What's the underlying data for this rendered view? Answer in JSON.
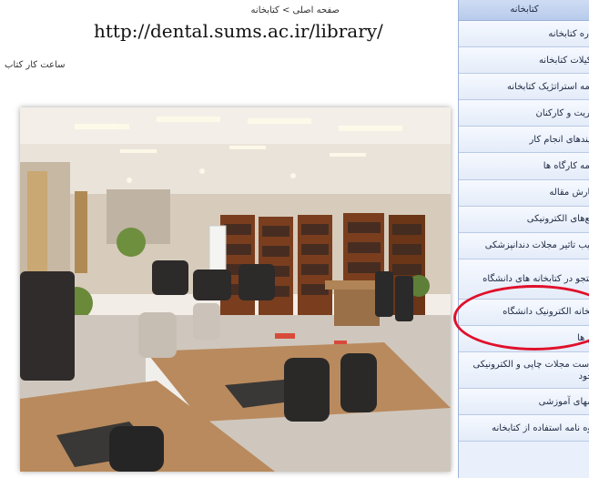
{
  "breadcrumb": "صفحه اصلی > کتابخانه",
  "url_overlay": "http://dental.sums.ac.ir/library/",
  "hours_text": "ساعت کار کتاب",
  "sidebar": {
    "header": "کتابخانه",
    "items": [
      {
        "label": "درباره کتابخانه"
      },
      {
        "label": "تشکیلات کتابخانه"
      },
      {
        "label": "برنامه استراتژیک کتابخانه"
      },
      {
        "label": "مدیریت و کارکنان"
      },
      {
        "label": "فرایندهای انجام کار"
      },
      {
        "label": "برنامه کارگاه ها"
      },
      {
        "label": "سفارش مقاله"
      },
      {
        "label": "منابع‌های الکترونیکی"
      },
      {
        "label": "ضریب تاثیر مجلات دندانپزشکی"
      },
      {
        "label": "جستجو در کتابخانه های دانشگاه"
      },
      {
        "label": "کتابخانه الکترونیک دانشگاه"
      },
      {
        "label": "فرم ها"
      },
      {
        "label": "فهرست مجلات چاپی و الکترونیکی موجود"
      },
      {
        "label": "فیلمهای آموزشی"
      },
      {
        "label": "شیوه نامه استفاده از کتابخانه"
      }
    ]
  },
  "colors": {
    "sidebar_bg": "#eaf0fb",
    "highlight_circle": "#e0102b"
  }
}
